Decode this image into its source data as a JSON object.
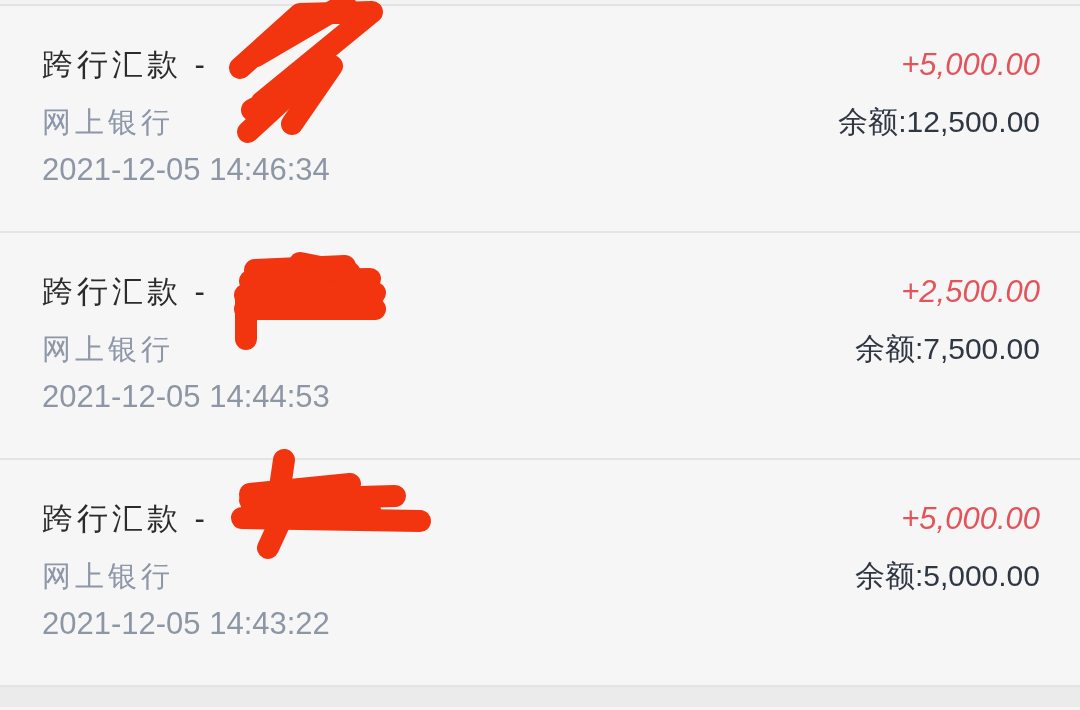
{
  "transactions": [
    {
      "title": "跨行汇款 -",
      "channel": "网上银行",
      "time": "2021-12-05 14:46:34",
      "amount": "+5,000.00",
      "balance": "余额:12,500.00"
    },
    {
      "title": "跨行汇款 -",
      "channel": "网上银行",
      "time": "2021-12-05 14:44:53",
      "amount": "+2,500.00",
      "balance": "余额:7,500.00"
    },
    {
      "title": "跨行汇款 -",
      "channel": "网上银行",
      "time": "2021-12-05 14:43:22",
      "amount": "+5,000.00",
      "balance": "余额:5,000.00"
    }
  ]
}
